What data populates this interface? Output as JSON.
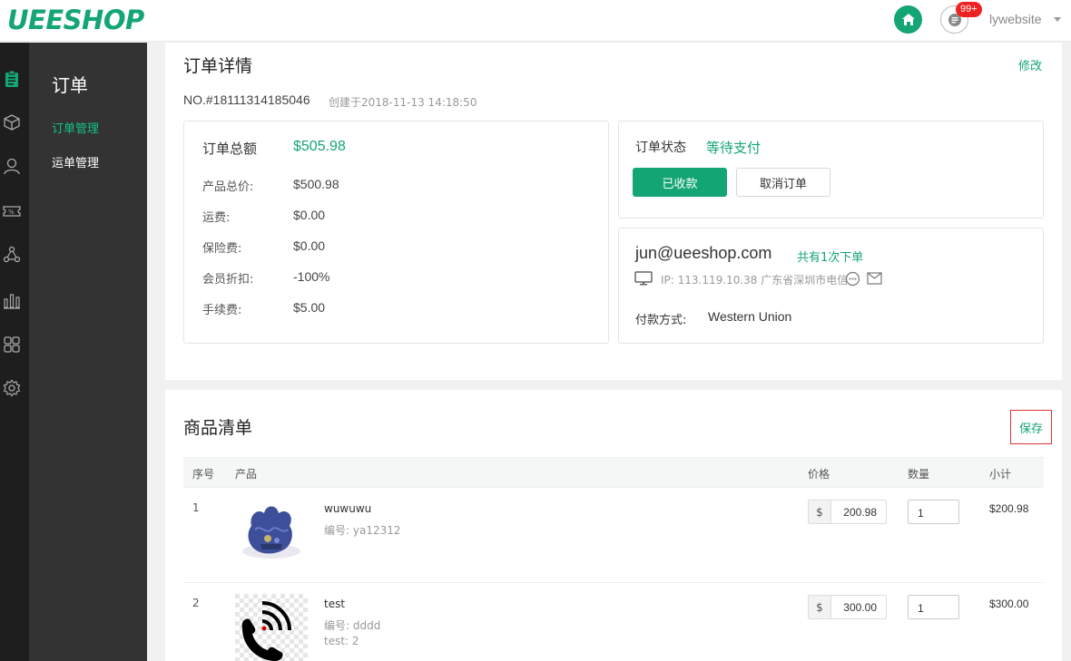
{
  "header": {
    "logo": "UEESHOP",
    "badge": "99+",
    "username": "lywebsite"
  },
  "sidebar": {
    "title": "订单",
    "items": [
      {
        "label": "订单管理",
        "active": true
      },
      {
        "label": "运单管理",
        "active": false
      }
    ],
    "icons": [
      "clipboard-icon",
      "box-icon",
      "user-icon",
      "coupon-icon",
      "share-icon",
      "chart-icon",
      "apps-icon",
      "gear-icon"
    ]
  },
  "order": {
    "title": "订单详情",
    "edit_label": "修改",
    "number": "NO.#18111314185046",
    "created": "创建于2018-11-13 14:18:50",
    "totals": {
      "total_label": "订单总额",
      "total_value": "$505.98",
      "rows": [
        {
          "label": "产品总价:",
          "value": "$500.98"
        },
        {
          "label": "运费:",
          "value": "$0.00"
        },
        {
          "label": "保险费:",
          "value": "$0.00"
        },
        {
          "label": "会员折扣:",
          "value": "-100%"
        },
        {
          "label": "手续费:",
          "value": "$5.00"
        }
      ]
    },
    "status": {
      "label": "订单状态",
      "value": "等待支付",
      "paid_button": "已收款",
      "cancel_button": "取消订单"
    },
    "customer": {
      "email": "jun@ueeshop.com",
      "orders_count": "共有1次下单",
      "ip": "IP: 113.119.10.38 广东省深圳市电信",
      "payment_label": "付款方式:",
      "payment_value": "Western Union"
    }
  },
  "products": {
    "title": "商品清单",
    "save_label": "保存",
    "columns": {
      "index": "序号",
      "product": "产品",
      "price": "价格",
      "qty": "数量",
      "subtotal": "小计"
    },
    "rows": [
      {
        "index": "1",
        "name": "wuwuwu",
        "sku": "编号: ya12312",
        "extra": "",
        "currency": "$",
        "price": "200.98",
        "qty": "1",
        "subtotal": "$200.98"
      },
      {
        "index": "2",
        "name": "test",
        "sku": "编号: dddd",
        "extra": "test: 2",
        "currency": "$",
        "price": "300.00",
        "qty": "1",
        "subtotal": "$300.00"
      }
    ]
  },
  "colors": {
    "accent": "#13a573",
    "sidebar_dark": "#1e1e1e",
    "sidebar": "#333333",
    "badge": "#ee2222"
  }
}
